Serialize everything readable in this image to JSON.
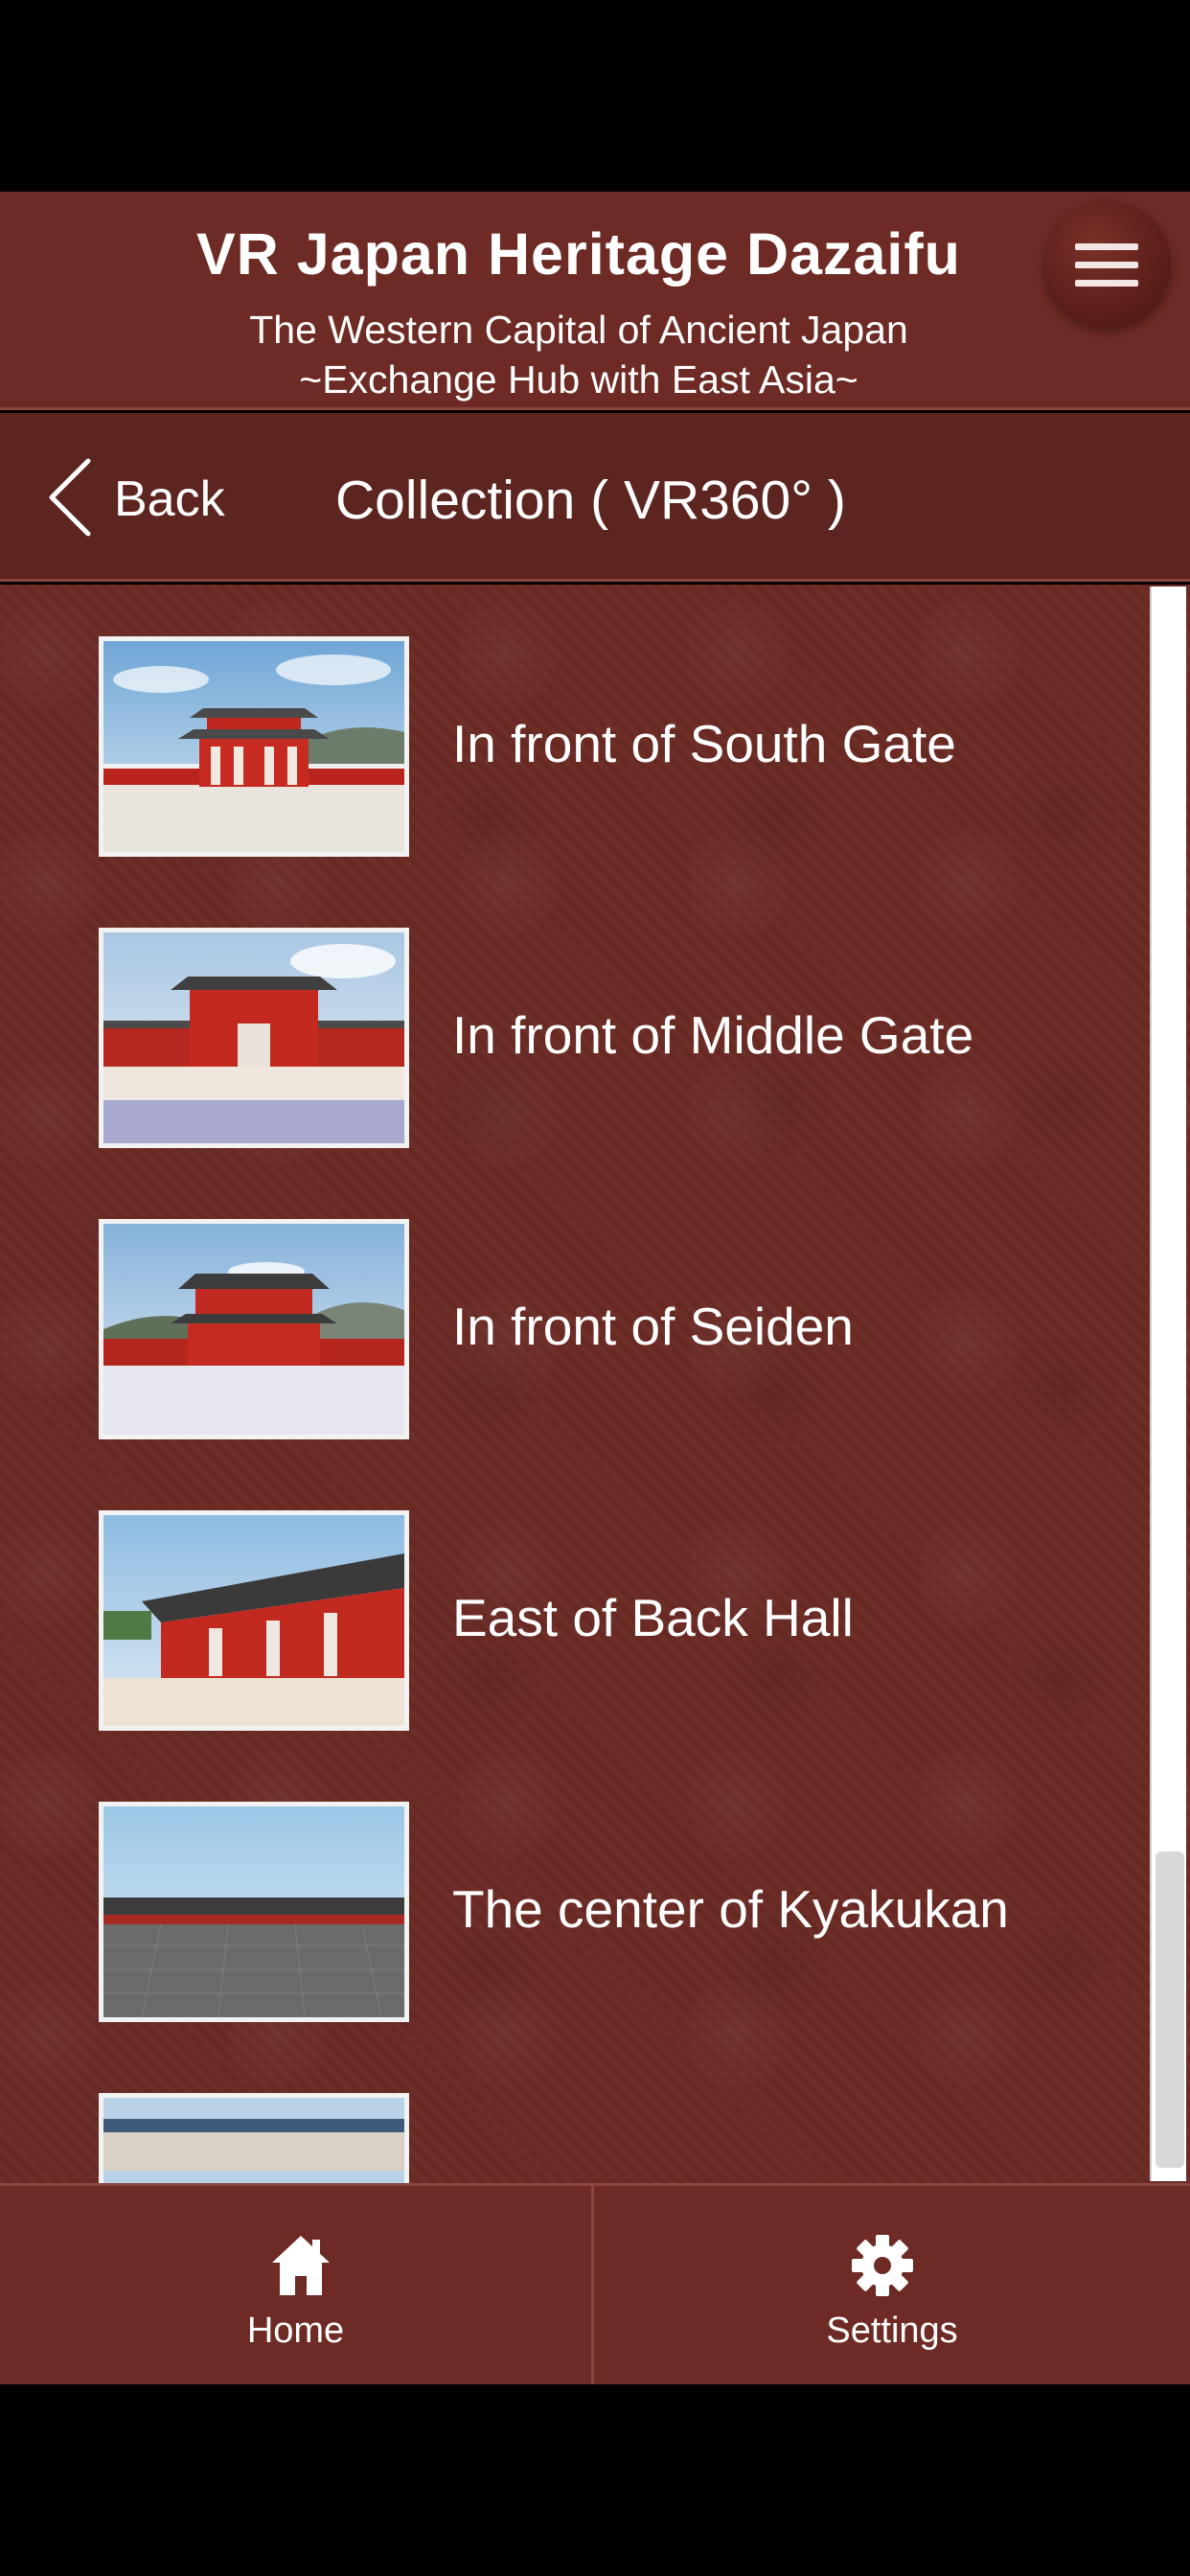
{
  "header": {
    "title": "VR Japan Heritage Dazaifu",
    "subtitle_line1": "The Western Capital of Ancient Japan",
    "subtitle_line2": "~Exchange Hub with East Asia~",
    "menu_icon": "hamburger-menu-icon"
  },
  "nav": {
    "back_label": "Back",
    "back_icon": "chevron-left-icon",
    "title": "Collection ( VR360° )"
  },
  "collection": {
    "items": [
      {
        "label": "In front of South Gate",
        "thumbnail": "south-gate-thumbnail"
      },
      {
        "label": "In front of Middle Gate",
        "thumbnail": "middle-gate-thumbnail"
      },
      {
        "label": "In front of Seiden",
        "thumbnail": "seiden-thumbnail"
      },
      {
        "label": "East of Back Hall",
        "thumbnail": "back-hall-thumbnail"
      },
      {
        "label": "The center of Kyakukan",
        "thumbnail": "kyakukan-thumbnail"
      },
      {
        "label": "",
        "thumbnail": "partially-visible-thumbnail"
      }
    ]
  },
  "tabs": {
    "home": {
      "label": "Home",
      "icon": "home-icon"
    },
    "settings": {
      "label": "Settings",
      "icon": "gear-icon"
    }
  },
  "colors": {
    "header_bg": "#6e2a24",
    "nav_bg": "#5d2520",
    "content_bg": "#6a2a24",
    "text": "#ffffff"
  }
}
